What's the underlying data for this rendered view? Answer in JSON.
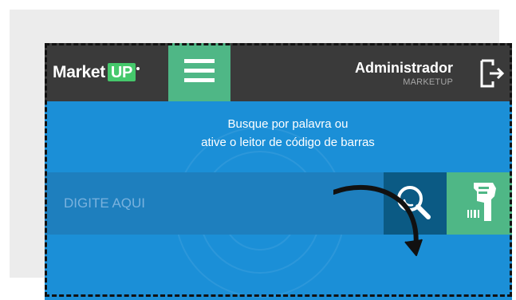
{
  "header": {
    "brand_text": "Market",
    "brand_badge": "UP",
    "user_name": "Administrador",
    "company": "MARKETUP"
  },
  "icons": {
    "menu": "menu-icon",
    "logout": "logout-icon",
    "search": "search-icon",
    "barcode": "barcode-scanner-icon"
  },
  "search": {
    "hint_line_1": "Busque por palavra ou",
    "hint_line_2": "ative o leitor de código de barras",
    "placeholder": "DIGITE AQUI"
  },
  "colors": {
    "header_bg": "#3a3a3a",
    "accent_green": "#4fb786",
    "main_blue": "#1b8fd7",
    "input_blue": "#1e7fbe",
    "search_button_blue": "#0b5a84",
    "outer_bg": "#ececec",
    "brand_badge_green": "#45c86b"
  }
}
